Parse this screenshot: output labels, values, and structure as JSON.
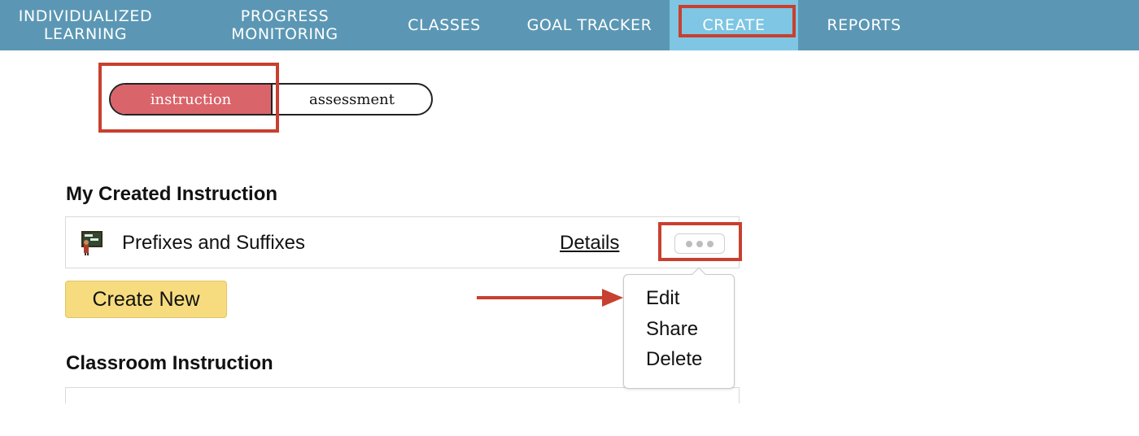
{
  "nav": {
    "items": [
      {
        "line1": "INDIVIDUALIZED",
        "line2": "LEARNING"
      },
      {
        "line1": "PROGRESS",
        "line2": "MONITORING"
      },
      {
        "label": "CLASSES"
      },
      {
        "label": "GOAL TRACKER"
      },
      {
        "label": "CREATE",
        "active": true
      },
      {
        "label": "REPORTS"
      }
    ]
  },
  "toggle": {
    "options": [
      "instruction",
      "assessment"
    ],
    "selected": "instruction"
  },
  "my_created": {
    "heading": "My Created Instruction",
    "items": [
      {
        "name": "Prefixes and Suffixes",
        "details_label": "Details",
        "icon": "noun-verb-chalkboard-icon"
      }
    ]
  },
  "create_button": "Create New",
  "classroom": {
    "heading": "Classroom Instruction"
  },
  "menu": {
    "items": [
      "Edit",
      "Share",
      "Delete"
    ]
  },
  "colors": {
    "nav_bg": "#5b97b4",
    "nav_active": "#7ec6e3",
    "toggle_active": "#d9646a",
    "create_button": "#f6dc7f",
    "annotation": "#c8402f"
  }
}
